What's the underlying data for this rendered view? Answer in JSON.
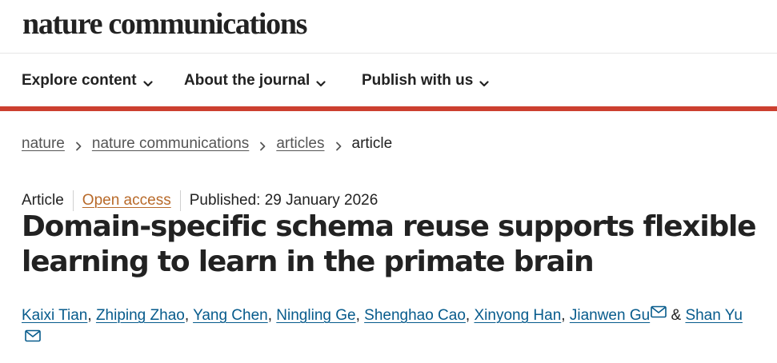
{
  "site": {
    "logo": "nature communications"
  },
  "nav": {
    "items": [
      {
        "label": "Explore content",
        "icon": "chevron-down-icon"
      },
      {
        "label": "About the journal",
        "icon": "chevron-down-icon"
      },
      {
        "label": "Publish with us",
        "icon": "chevron-down-icon"
      }
    ]
  },
  "colors": {
    "accent_rule": "#cc3f2f",
    "author_link": "#075b8c",
    "open_access": "#b86a2a",
    "text": "#222222"
  },
  "breadcrumb": {
    "items": [
      "nature",
      "nature communications",
      "articles"
    ],
    "current": "article",
    "separator_icon": "chevron-right-icon"
  },
  "article": {
    "type": "Article",
    "access": "Open access",
    "published": "Published: 29 January 2026",
    "title": "Domain-specific schema reuse supports flexible learning to learn in the primate brain",
    "authors": [
      {
        "name": "Kaixi Tian",
        "sep": ","
      },
      {
        "name": "Zhiping Zhao",
        "sep": ","
      },
      {
        "name": "Yang Chen",
        "sep": ","
      },
      {
        "name": "Ningling Ge",
        "sep": ","
      },
      {
        "name": "Shenghao Cao",
        "sep": ","
      },
      {
        "name": "Xinyong Han",
        "sep": ","
      },
      {
        "name": "Jianwen Gu",
        "corresponding": true,
        "sep": "&"
      },
      {
        "name": "Shan Yu",
        "corresponding": true,
        "sep": ""
      }
    ],
    "author_separators": {
      "comma": ",",
      "and": "&"
    },
    "mail_icon": "mail-icon"
  }
}
